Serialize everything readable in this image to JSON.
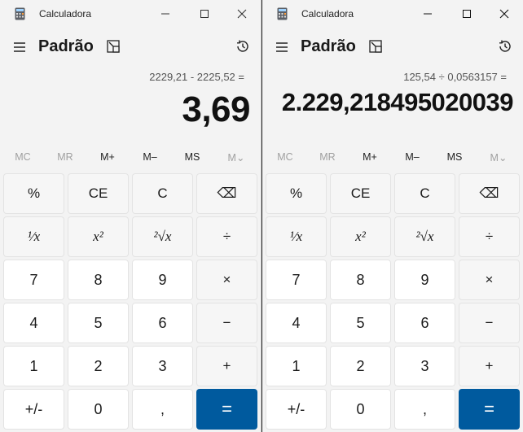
{
  "windows": [
    {
      "title": "Calculadora",
      "mode": "Padrão",
      "expression": "2229,21 - 2225,52 =",
      "display": "3,69",
      "memory": [
        {
          "label": "MC",
          "enabled": false
        },
        {
          "label": "MR",
          "enabled": false
        },
        {
          "label": "M+",
          "enabled": true
        },
        {
          "label": "M–",
          "enabled": true
        },
        {
          "label": "MS",
          "enabled": true
        },
        {
          "label": "M⌄",
          "enabled": false
        }
      ]
    },
    {
      "title": "Calculadora",
      "mode": "Padrão",
      "expression": "125,54 ÷ 0,0563157 =",
      "display": "2.229,218495020039",
      "memory": [
        {
          "label": "MC",
          "enabled": false
        },
        {
          "label": "MR",
          "enabled": false
        },
        {
          "label": "M+",
          "enabled": true
        },
        {
          "label": "M–",
          "enabled": true
        },
        {
          "label": "MS",
          "enabled": true
        },
        {
          "label": "M⌄",
          "enabled": false
        }
      ]
    }
  ],
  "keys": {
    "percent": "%",
    "ce": "CE",
    "c": "C",
    "backspace": "⌫",
    "reciprocal": "¹⁄x",
    "square": "x²",
    "sqrt": "²√x",
    "divide": "÷",
    "seven": "7",
    "eight": "8",
    "nine": "9",
    "multiply": "×",
    "four": "4",
    "five": "5",
    "six": "6",
    "minus": "−",
    "one": "1",
    "two": "2",
    "three": "3",
    "plus": "+",
    "negate": "+/-",
    "zero": "0",
    "decimal": ",",
    "equals": "="
  },
  "colors": {
    "accent": "#005a9e",
    "window_bg": "#f3f3f3",
    "number_key": "#ffffff",
    "op_key": "#f6f6f6"
  }
}
